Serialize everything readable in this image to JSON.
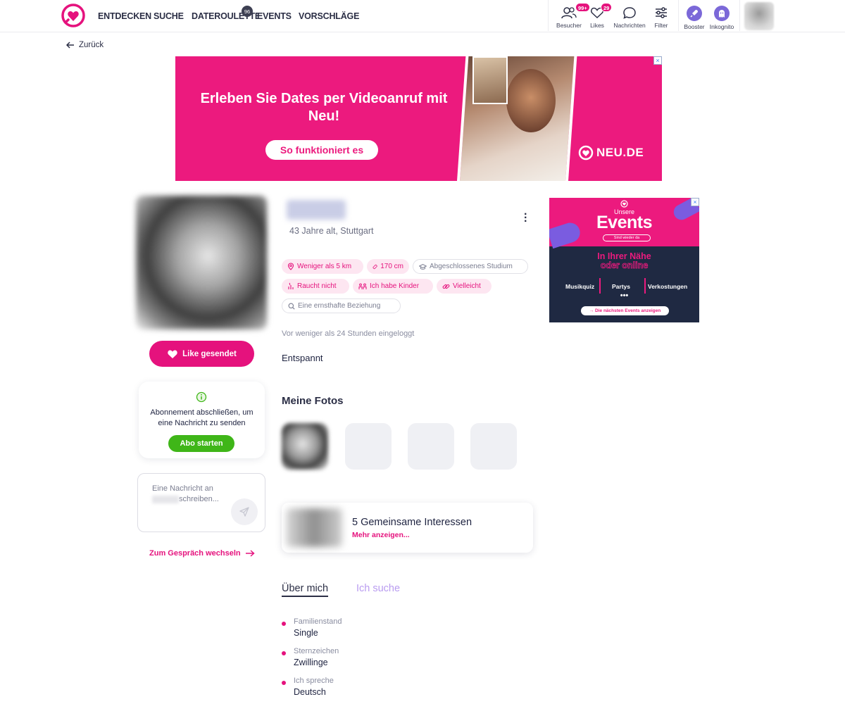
{
  "header": {
    "nav": [
      {
        "label": "ENTDECKEN"
      },
      {
        "label": "SUCHE"
      },
      {
        "label": "DATEROULETTE",
        "badge": "96"
      },
      {
        "label": "EVENTS"
      },
      {
        "label": "VORSCHLÄGE"
      }
    ],
    "icons": [
      {
        "label": "Besucher",
        "badge": "99+",
        "icon": "visitors-icon"
      },
      {
        "label": "Likes",
        "badge": "29",
        "icon": "heart-icon"
      },
      {
        "label": "Nachrichten",
        "icon": "chat-bubble-icon"
      },
      {
        "label": "Filter",
        "icon": "sliders-icon"
      },
      {
        "label": "Booster",
        "icon": "rocket-icon"
      },
      {
        "label": "Inkognito",
        "icon": "ghost-icon"
      }
    ]
  },
  "back_label": "Zurück",
  "banner": {
    "title": "Erleben Sie Dates per Videoanruf mit Neu!",
    "button": "So funktioniert es",
    "brand": "NEU.DE",
    "close": "×"
  },
  "left": {
    "like_button": "Like gesendet",
    "abo_text": "Abonnement abschließen, um eine Nachricht zu senden",
    "abo_button": "Abo starten",
    "message_placeholder_start": "Eine Nachricht an",
    "message_placeholder_end": "schreiben...",
    "switch_link": "Zum Gespräch wechseln"
  },
  "profile": {
    "age_location": "43 Jahre alt, Stuttgart",
    "chips": [
      {
        "label": "Weniger als 5 km",
        "icon": "location-pin-icon",
        "style": "pink"
      },
      {
        "label": "170 cm",
        "icon": "ruler-icon",
        "style": "pink"
      },
      {
        "label": "Abgeschlossenes Studium",
        "icon": "graduation-cap-icon",
        "style": "grey"
      },
      {
        "label": "Raucht nicht",
        "icon": "no-smoking-icon",
        "style": "pink"
      },
      {
        "label": "Ich habe Kinder",
        "icon": "family-icon",
        "style": "pink"
      },
      {
        "label": "Vielleicht",
        "icon": "link-icon",
        "style": "pink"
      },
      {
        "label": "Eine ernsthafte Beziehung",
        "icon": "search-icon",
        "style": "grey"
      }
    ],
    "last_login": "Vor weniger als 24 Stunden eingeloggt",
    "mood": "Entspannt",
    "photos_title": "Meine Fotos",
    "interests_title": "5 Gemeinsame Interessen",
    "interests_more": "Mehr anzeigen...",
    "tabs": [
      {
        "label": "Über mich",
        "active": true
      },
      {
        "label": "Ich suche",
        "active": false
      }
    ],
    "attributes": [
      {
        "key": "Familienstand",
        "value": "Single"
      },
      {
        "key": "Sternzeichen",
        "value": "Zwillinge"
      },
      {
        "key": "Ich spreche",
        "value": "Deutsch"
      }
    ]
  },
  "events_ad": {
    "unsere": "Unsere",
    "events": "Events",
    "pill": "Sind wieder da",
    "near_1": "In Ihrer Nähe",
    "near_2": "oder online",
    "items": [
      "Musikquiz",
      "Partys",
      "Verkostungen"
    ],
    "dots": "•••",
    "cta": "→ Die nächsten Events anzeigen",
    "close": "×"
  },
  "colors": {
    "brand_pink": "#e5127d",
    "banner_pink": "#ec1a7e",
    "green": "#3fb618",
    "navy": "#1f2942",
    "lavender": "#b99cf0"
  }
}
